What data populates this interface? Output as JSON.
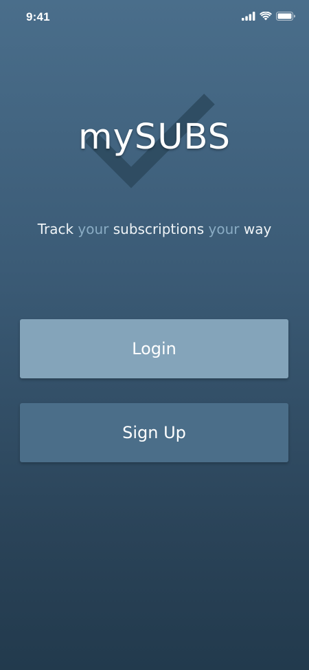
{
  "status_bar": {
    "time": "9:41",
    "icons": [
      "cellular-signal-icon",
      "wifi-icon",
      "battery-icon"
    ]
  },
  "app": {
    "title": "mySUBS",
    "logo_icon": "checkmark-icon",
    "tagline": {
      "part1": "Track ",
      "accent1": "your",
      "part2": " subscriptions ",
      "accent2": "your",
      "part3": " way"
    }
  },
  "actions": {
    "login_label": "Login",
    "signup_label": "Sign Up"
  },
  "colors": {
    "background_top": "#4a6e8b",
    "background_bottom": "#223a4d",
    "accent_text": "#8aacc4",
    "login_button": "#84a4ba",
    "signup_button": "#4b6e89",
    "checkmark": "#2e4a5f"
  }
}
